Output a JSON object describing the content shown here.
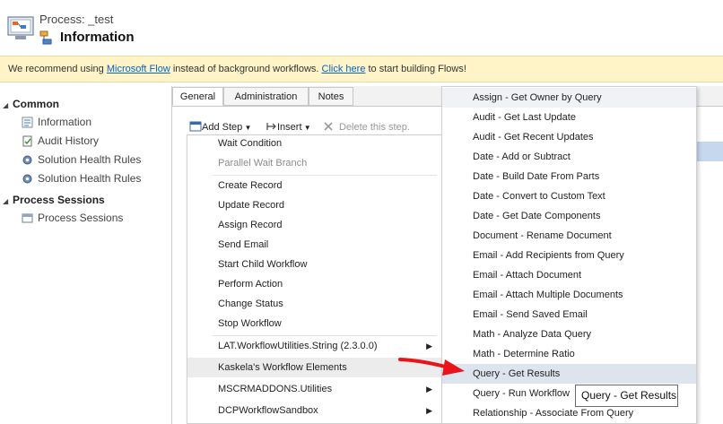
{
  "header": {
    "subtitle": "Process: _test",
    "title": "Information"
  },
  "banner": {
    "prefix": "We recommend using ",
    "link1": "Microsoft Flow",
    "middle": " instead of background workflows. ",
    "link2": "Click here",
    "suffix": " to start building Flows!"
  },
  "nav": {
    "common_label": "Common",
    "common_items": [
      {
        "label": "Information",
        "icon": "document-icon"
      },
      {
        "label": "Audit History",
        "icon": "audit-icon"
      },
      {
        "label": "Solution Health Rules",
        "icon": "gear-icon"
      },
      {
        "label": "Solution Health Rules",
        "icon": "gear-icon"
      }
    ],
    "sessions_label": "Process Sessions",
    "sessions_items": [
      {
        "label": "Process Sessions",
        "icon": "sessions-icon"
      }
    ]
  },
  "tabs": [
    "General",
    "Administration",
    "Notes"
  ],
  "toolbar": {
    "add_step": "Add Step",
    "insert": "Insert",
    "delete": "Delete this step."
  },
  "step_menu": {
    "items": [
      {
        "label": "Wait Condition",
        "disabled": false
      },
      {
        "label": "Parallel Wait Branch",
        "disabled": true
      },
      {
        "label": "Create Record",
        "disabled": false
      },
      {
        "label": "Update Record",
        "disabled": false
      },
      {
        "label": "Assign Record",
        "disabled": false
      },
      {
        "label": "Send Email",
        "disabled": false
      },
      {
        "label": "Start Child Workflow",
        "disabled": false
      },
      {
        "label": "Perform Action",
        "disabled": false
      },
      {
        "label": "Change Status",
        "disabled": false
      },
      {
        "label": "Stop Workflow",
        "disabled": false
      },
      {
        "label": "LAT.WorkflowUtilities.String (2.3.0.0)",
        "disabled": false,
        "submenu": true
      },
      {
        "label": "Kaskela's Workflow Elements",
        "disabled": false,
        "submenu": true,
        "hover": true
      },
      {
        "label": "MSCRMADDONS.Utilities",
        "disabled": false,
        "submenu": true
      },
      {
        "label": "DCPWorkflowSandbox",
        "disabled": false,
        "submenu": true
      }
    ]
  },
  "sub_menu": {
    "items": [
      "Assign - Get Owner by Query",
      "Audit - Get Last Update",
      "Audit - Get Recent Updates",
      "Date - Add or Subtract",
      "Date - Build Date From Parts",
      "Date - Convert to Custom Text",
      "Date - Get Date Components",
      "Document - Rename Document",
      "Email - Add Recipients from Query",
      "Email - Attach Document",
      "Email - Attach Multiple Documents",
      "Email - Send Saved Email",
      "Math - Analyze Data Query",
      "Math - Determine Ratio",
      "Query - Get Results",
      "Query - Run Workflow",
      "Relationship - Associate From Query"
    ],
    "highlighted_index": 14
  },
  "tooltip": "Query - Get Results",
  "colors": {
    "banner_bg": "#fff4c8",
    "link": "#0563c1",
    "highlight": "#dde4ee",
    "arrow": "#e8141a"
  }
}
